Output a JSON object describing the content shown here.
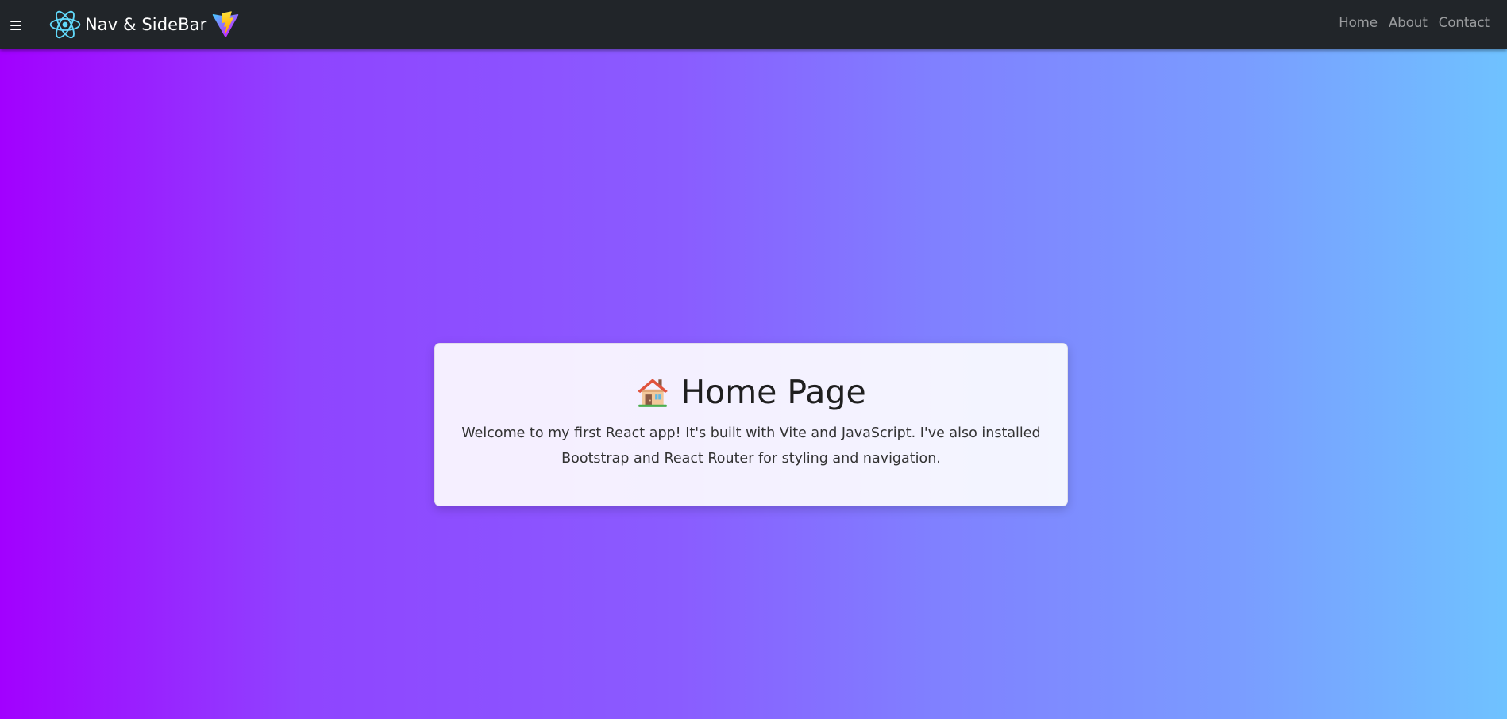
{
  "navbar": {
    "brand_text": "Nav & SideBar",
    "menu_icon": "hamburger-menu-icon",
    "brand_icons": [
      "react-logo-icon",
      "vite-logo-icon"
    ],
    "links": [
      {
        "label": "Home"
      },
      {
        "label": "About"
      },
      {
        "label": "Contact"
      }
    ],
    "background_color": "#212529"
  },
  "main": {
    "title_icon": "house-icon",
    "title": "Home Page",
    "description": "Welcome to my first React app! It's built with Vite and JavaScript. I've also installed Bootstrap and React Router for styling and navigation."
  },
  "colors": {
    "gradient_start": "#a200ff",
    "gradient_end": "#6fc2ff"
  }
}
